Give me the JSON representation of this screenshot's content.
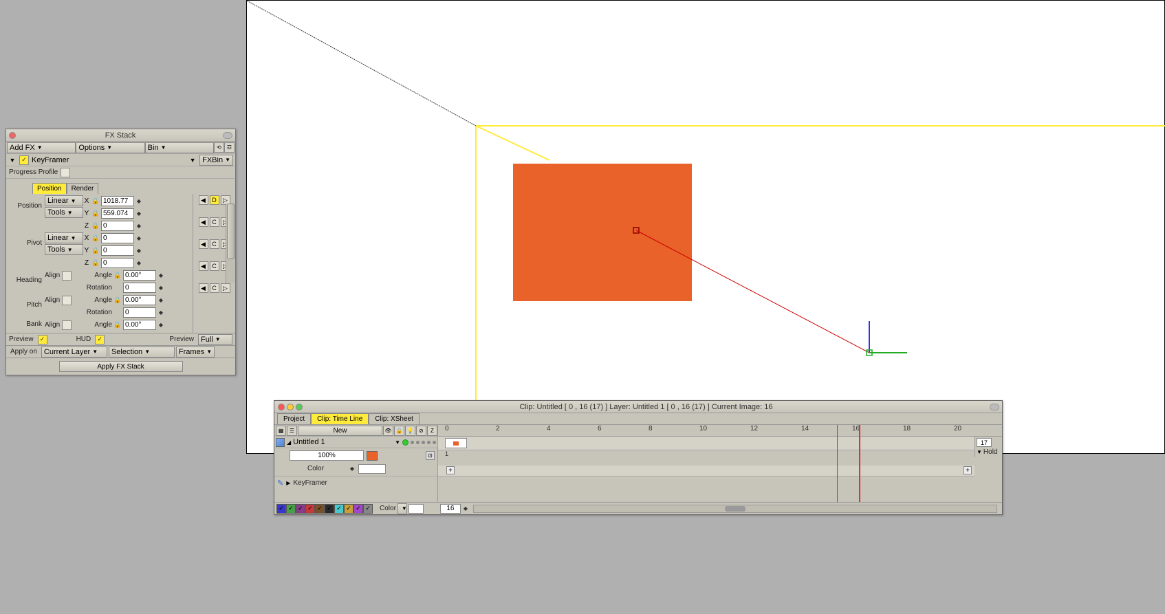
{
  "fx": {
    "title": "FX Stack",
    "menus": {
      "add": "Add FX",
      "options": "Options",
      "bin": "Bin"
    },
    "keyframer": {
      "label": "KeyFramer",
      "fxbin": "FXBin"
    },
    "progress": "Progress Profile",
    "tabs": {
      "position": "Position",
      "render": "Render"
    },
    "position": {
      "label": "Position",
      "interp": "Linear",
      "tools": "Tools",
      "x": "1018.77",
      "y": "559.074",
      "z": "0"
    },
    "pivot": {
      "label": "Pivot",
      "interp": "Linear",
      "tools": "Tools",
      "x": "0",
      "y": "0",
      "z": "0"
    },
    "heading": {
      "label": "Heading",
      "align": "Align",
      "angle_lbl": "Angle",
      "rotation_lbl": "Rotation",
      "angle": "0.00°",
      "rotation": "0"
    },
    "pitch": {
      "label": "Pitch",
      "align": "Align",
      "angle_lbl": "Angle",
      "rotation_lbl": "Rotation",
      "angle": "0.00°",
      "rotation": "0"
    },
    "bank": {
      "label": "Bank",
      "align": "Align",
      "angle_lbl": "Angle",
      "angle": "0.00°"
    },
    "axes": {
      "x": "X",
      "y": "Y",
      "z": "Z"
    },
    "motion": {
      "d": "D",
      "c": "C"
    },
    "bottom": {
      "preview": "Preview",
      "hud": "HUD",
      "preview2": "Preview",
      "full": "Full"
    },
    "apply": {
      "label": "Apply on",
      "layer": "Current Layer",
      "selection": "Selection",
      "frames": "Frames",
      "btn": "Apply FX Stack"
    }
  },
  "timeline": {
    "title": "Clip: Untitled [ 0 , 16  (17) ]       Layer: Untitled 1 [ 0 , 16  (17) ]    Current Image: 16",
    "tabs": {
      "project": "Project",
      "timeline": "Clip: Time Line",
      "xsheet": "Clip: XSheet"
    },
    "new": "New",
    "layer": {
      "name": "Untitled 1",
      "opacity": "100%",
      "color_lbl": "Color"
    },
    "keyframer": "KeyFramer",
    "ruler": [
      "0",
      "2",
      "4",
      "6",
      "8",
      "10",
      "12",
      "14",
      "16",
      "18",
      "20"
    ],
    "end": "17",
    "hold": "Hold",
    "color_label": "Color",
    "frame": "16",
    "swatches": [
      "#3838c8",
      "#48a048",
      "#8a3a8a",
      "#c83838",
      "#7a5028",
      "#2a2a2a",
      "#48c8c8",
      "#c8a038",
      "#a048c8",
      "#888888"
    ]
  }
}
